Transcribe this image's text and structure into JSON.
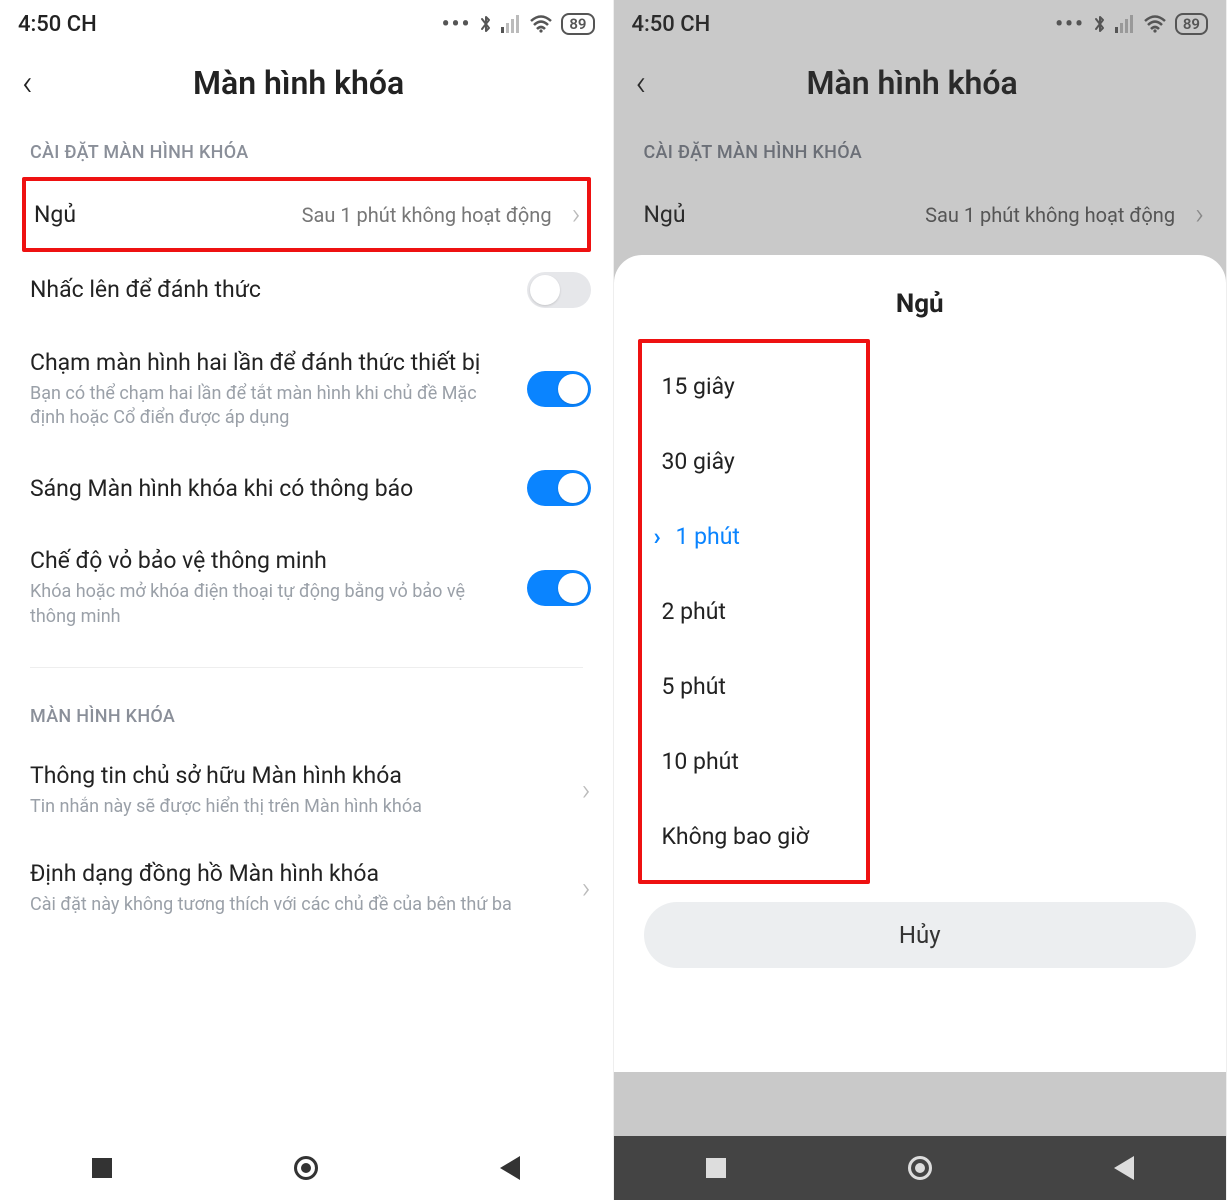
{
  "status": {
    "time": "4:50 CH",
    "battery": "89"
  },
  "left": {
    "title": "Màn hình khóa",
    "section1": "CÀI ĐẶT MÀN HÌNH KHÓA",
    "items": {
      "sleep": {
        "title": "Ngủ",
        "value": "Sau 1 phút không hoạt động"
      },
      "raise": {
        "title": "Nhấc lên để đánh thức"
      },
      "double_tap": {
        "title": "Chạm màn hình hai lần để đánh thức thiết bị",
        "sub": "Bạn có thể chạm hai lần để tắt màn hình khi chủ đề Mặc định hoặc Cổ điển được áp dụng"
      },
      "wake_notif": {
        "title": "Sáng Màn hình khóa khi có thông báo"
      },
      "smart_cover": {
        "title": "Chế độ vỏ bảo vệ thông minh",
        "sub": "Khóa hoặc mở khóa điện thoại tự động bằng vỏ bảo vệ thông minh"
      }
    },
    "section2": "MÀN HÌNH KHÓA",
    "items2": {
      "owner": {
        "title": "Thông tin chủ sở hữu Màn hình khóa",
        "sub": "Tin nhắn này sẽ được hiển thị trên Màn hình khóa"
      },
      "clock": {
        "title": "Định dạng đồng hồ Màn hình khóa",
        "sub": "Cài đặt này không tương thích với các chủ đề của bên thứ ba"
      }
    }
  },
  "right": {
    "title": "Màn hình khóa",
    "section1": "CÀI ĐẶT MÀN HÌNH KHÓA",
    "sleep": {
      "title": "Ngủ",
      "value": "Sau 1 phút không hoạt động"
    },
    "sheet": {
      "title": "Ngủ",
      "options": [
        "15 giây",
        "30 giây",
        "1 phút",
        "2 phút",
        "5 phút",
        "10 phút",
        "Không bao giờ"
      ],
      "selected_index": 2,
      "cancel": "Hủy"
    }
  }
}
